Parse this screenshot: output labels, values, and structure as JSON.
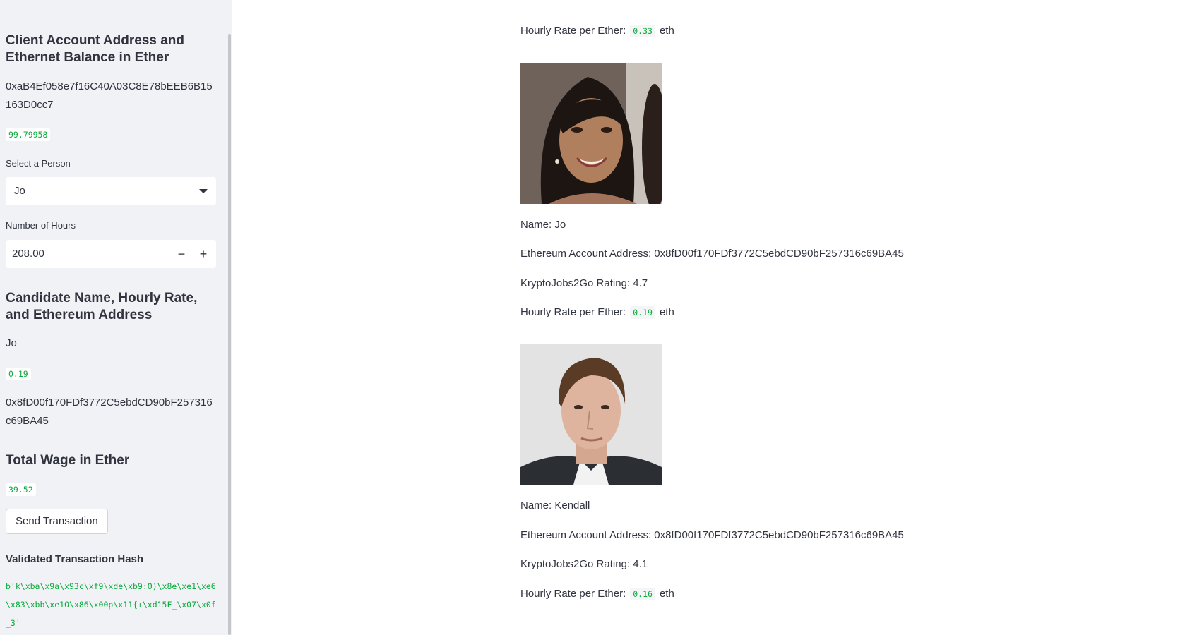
{
  "sidebar": {
    "client_heading": "Client Account Address and Ethernet Balance in Ether",
    "client_address": "0xaB4Ef058e7f16C40A03C8E78bEEB6B15163D0cc7",
    "client_balance": "99.79958",
    "select_label": "Select a Person",
    "select_value": "Jo",
    "hours_label": "Number of Hours",
    "hours_value": "208.00",
    "minus": "−",
    "plus": "+",
    "candidate_heading": "Candidate Name, Hourly Rate, and Ethereum Address",
    "candidate_name": "Jo",
    "candidate_rate": "0.19",
    "candidate_address": "0x8fD00f170FDf3772C5ebdCD90bF257316c69BA45",
    "wage_heading": "Total Wage in Ether",
    "wage_value": "39.52",
    "send_button": "Send Transaction",
    "hash_heading": "Validated Transaction Hash",
    "hash_value": "b'k\\xba\\x9a\\x93c\\xf9\\xde\\xb9:O)\\x8e\\xe1\\xe6\\x83\\xbb\\xe1O\\x86\\x00p\\x11{+\\xd15F_\\x07\\x0f_3'"
  },
  "main": {
    "top_rate_label": "Hourly Rate per Ether:",
    "top_rate_value": "0.33",
    "top_rate_unit": "eth",
    "candidates": [
      {
        "name_text": "Name: Jo",
        "address_text": "Ethereum Account Address: 0x8fD00f170FDf3772C5ebdCD90bF257316c69BA45",
        "rating_text": "KryptoJobs2Go Rating: 4.7",
        "rate_label": "Hourly Rate per Ether:",
        "rate_value": "0.19",
        "rate_unit": "eth"
      },
      {
        "name_text": "Name: Kendall",
        "address_text": "Ethereum Account Address: 0x8fD00f170FDf3772C5ebdCD90bF257316c69BA45",
        "rating_text": "KryptoJobs2Go Rating: 4.1",
        "rate_label": "Hourly Rate per Ether:",
        "rate_value": "0.16",
        "rate_unit": "eth"
      }
    ]
  },
  "colors": {
    "accent_green": "#09ab3b",
    "sidebar_bg": "#f0f2f6",
    "text": "#31333f"
  }
}
